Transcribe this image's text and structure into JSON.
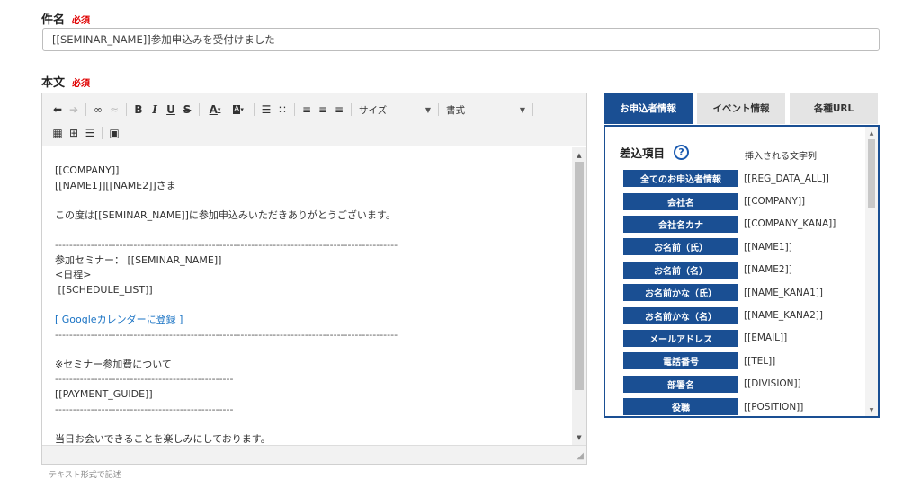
{
  "subject": {
    "label": "件名",
    "required": "必須",
    "value": "[[SEMINAR_NAME]]参加申込みを受付けました"
  },
  "body": {
    "label": "本文",
    "required": "必須"
  },
  "toolbar": {
    "size_label": "サイズ",
    "format_label": "書式"
  },
  "editor": {
    "lines": [
      "[[COMPANY]]",
      "[[NAME1]][[NAME2]]さま",
      "",
      "この度は[[SEMINAR_NAME]]に参加申込みいただきありがとうございます。",
      "",
      "------------------------------------------------------------------------------------------------",
      "参加セミナー： [[SEMINAR_NAME]]",
      "<日程>",
      " [[SCHEDULE_LIST]]",
      "",
      "[ Googleカレンダーに登録 ]",
      "------------------------------------------------------------------------------------------------",
      "",
      "※セミナー参加費について",
      "--------------------------------------------------",
      "[[PAYMENT_GUIDE]]",
      "--------------------------------------------------",
      "",
      "当日お会いできることを楽しみにしております。"
    ]
  },
  "help_text": "テキスト形式で記述",
  "panel": {
    "tabs": [
      {
        "label": "お申込者情報",
        "active": true
      },
      {
        "label": "イベント情報",
        "active": false
      },
      {
        "label": "各種URL",
        "active": false
      }
    ],
    "heading": "差込項目",
    "help_glyph": "?",
    "column_right": "挿入される文字列",
    "items": [
      {
        "label": "全てのお申込者情報",
        "value": "[[REG_DATA_ALL]]"
      },
      {
        "label": "会社名",
        "value": "[[COMPANY]]"
      },
      {
        "label": "会社名カナ",
        "value": "[[COMPANY_KANA]]"
      },
      {
        "label": "お名前（氏）",
        "value": "[[NAME1]]"
      },
      {
        "label": "お名前（名）",
        "value": "[[NAME2]]"
      },
      {
        "label": "お名前かな（氏）",
        "value": "[[NAME_KANA1]]"
      },
      {
        "label": "お名前かな（名）",
        "value": "[[NAME_KANA2]]"
      },
      {
        "label": "メールアドレス",
        "value": "[[EMAIL]]"
      },
      {
        "label": "電話番号",
        "value": "[[TEL]]"
      },
      {
        "label": "部署名",
        "value": "[[DIVISION]]"
      },
      {
        "label": "役職",
        "value": "[[POSITION]]"
      }
    ]
  },
  "colors": {
    "accent": "#1a4f93",
    "required": "#e00000",
    "link": "#1a73c4"
  }
}
